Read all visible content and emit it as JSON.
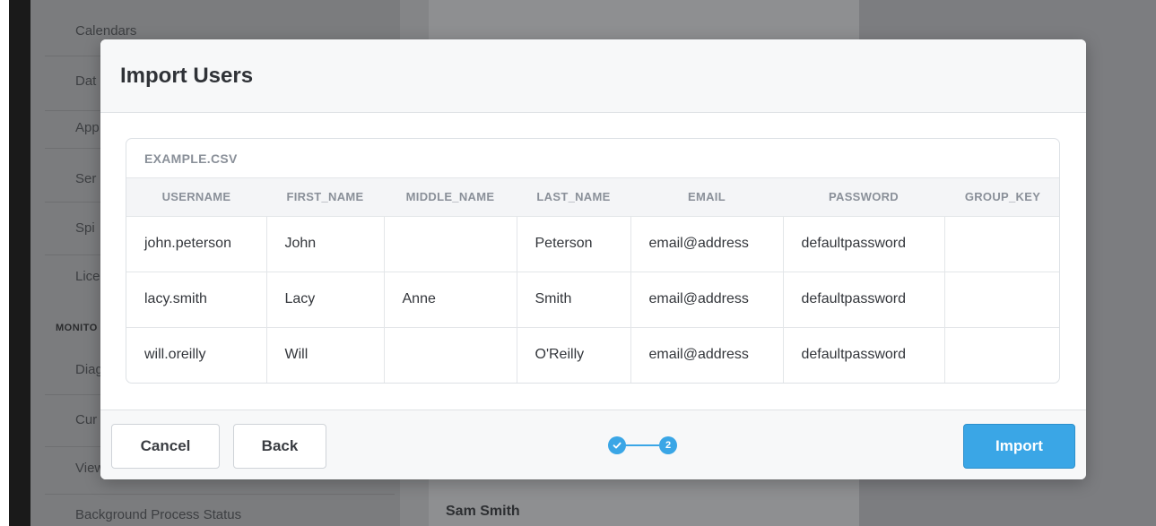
{
  "background": {
    "sidebar_items": [
      {
        "label": "Calendars"
      },
      {
        "label": "Dat"
      },
      {
        "label": "App"
      },
      {
        "label": "Ser"
      },
      {
        "label": "Spi"
      },
      {
        "label": "Lice"
      },
      {
        "label": "Diag"
      },
      {
        "label": "Cur"
      },
      {
        "label": "View"
      },
      {
        "label": "Background Process Status"
      }
    ],
    "sidebar_section": "MONITO",
    "main_name": "Sam Smith"
  },
  "modal": {
    "title": "Import Users",
    "csv": {
      "title": "EXAMPLE.CSV",
      "columns": [
        "USERNAME",
        "FIRST_NAME",
        "MIDDLE_NAME",
        "LAST_NAME",
        "EMAIL",
        "PASSWORD",
        "GROUP_KEY"
      ],
      "rows": [
        [
          "john.peterson",
          "John",
          "",
          "Peterson",
          "email@address",
          "defaultpassword",
          ""
        ],
        [
          "lacy.smith",
          "Lacy",
          "Anne",
          "Smith",
          "email@address",
          "defaultpassword",
          ""
        ],
        [
          "will.oreilly",
          "Will",
          "",
          "O'Reilly",
          "email@address",
          "defaultpassword",
          ""
        ]
      ]
    },
    "footer": {
      "cancel_label": "Cancel",
      "back_label": "Back",
      "import_label": "Import",
      "stepper": {
        "step1_icon": "check-icon",
        "step2_label": "2",
        "current_step": 2
      }
    }
  },
  "colors": {
    "accent": "#3aa6e6",
    "overlay": "#808285"
  }
}
